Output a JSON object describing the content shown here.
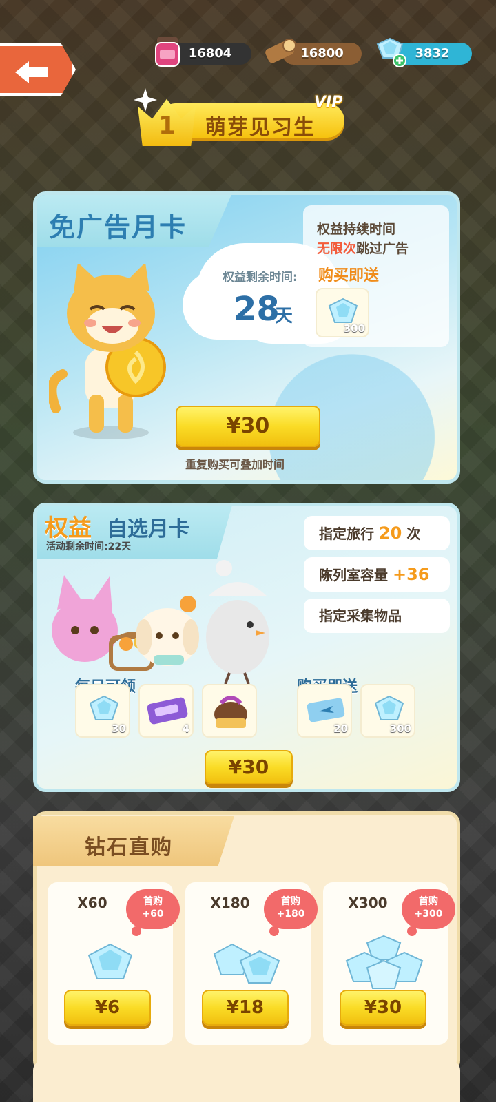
{
  "topbar": {
    "back_icon": "arrow-left-icon",
    "resources": [
      {
        "name": "jam",
        "icon": "jam-jar-icon",
        "value": "16804",
        "color": "#d94a86"
      },
      {
        "name": "wood",
        "icon": "wood-log-icon",
        "value": "16800",
        "color": "#9a6a3c"
      },
      {
        "name": "diamond",
        "icon": "diamond-plus-icon",
        "value": "3832",
        "color": "#3cc3e0"
      }
    ]
  },
  "vip": {
    "level": "1",
    "name": "萌芽见习生",
    "tag": "VIP"
  },
  "adfree_card": {
    "title": "免广告月卡",
    "remaining_label": "权益剩余时间:",
    "remaining_value": "28",
    "remaining_unit": "天",
    "benefit_line1": "权益持续时间",
    "benefit_line2_highlight": "无限次",
    "benefit_line2_rest": "跳过广告",
    "gift_label": "购买即送",
    "gift": {
      "icon": "diamond-icon",
      "qty": "300"
    },
    "price": "¥30",
    "note": "重复购买可叠加时间"
  },
  "select_card": {
    "title_a": "权益",
    "title_b": "自选月卡",
    "subtitle": "活动剩余时间:22天",
    "perks": [
      {
        "pre": "指定旅行",
        "num": "20",
        "post": "次"
      },
      {
        "pre": "陈列室容量",
        "num": "+36",
        "post": ""
      },
      {
        "pre": "指定采集物品",
        "num": "",
        "post": ""
      }
    ],
    "daily_label": "每日可领",
    "daily_items": [
      {
        "icon": "diamond-icon",
        "qty": "30"
      },
      {
        "icon": "ticket-icon",
        "qty": "4"
      },
      {
        "icon": "mystery-item-icon",
        "qty": ""
      }
    ],
    "gift_label": "购买即送",
    "gift_items": [
      {
        "icon": "plane-ticket-icon",
        "qty": "20"
      },
      {
        "icon": "diamond-icon",
        "qty": "300"
      }
    ],
    "price": "¥30"
  },
  "diamond_shop": {
    "title": "钻石直购",
    "items": [
      {
        "qty": "X60",
        "bonus_label": "首购",
        "bonus": "+60",
        "price": "¥6",
        "icon": "diamond-small-icon"
      },
      {
        "qty": "X180",
        "bonus_label": "首购",
        "bonus": "+180",
        "price": "¥18",
        "icon": "diamond-pair-icon"
      },
      {
        "qty": "X300",
        "bonus_label": "首购",
        "bonus": "+300",
        "price": "¥30",
        "icon": "diamond-pile-icon"
      }
    ]
  }
}
